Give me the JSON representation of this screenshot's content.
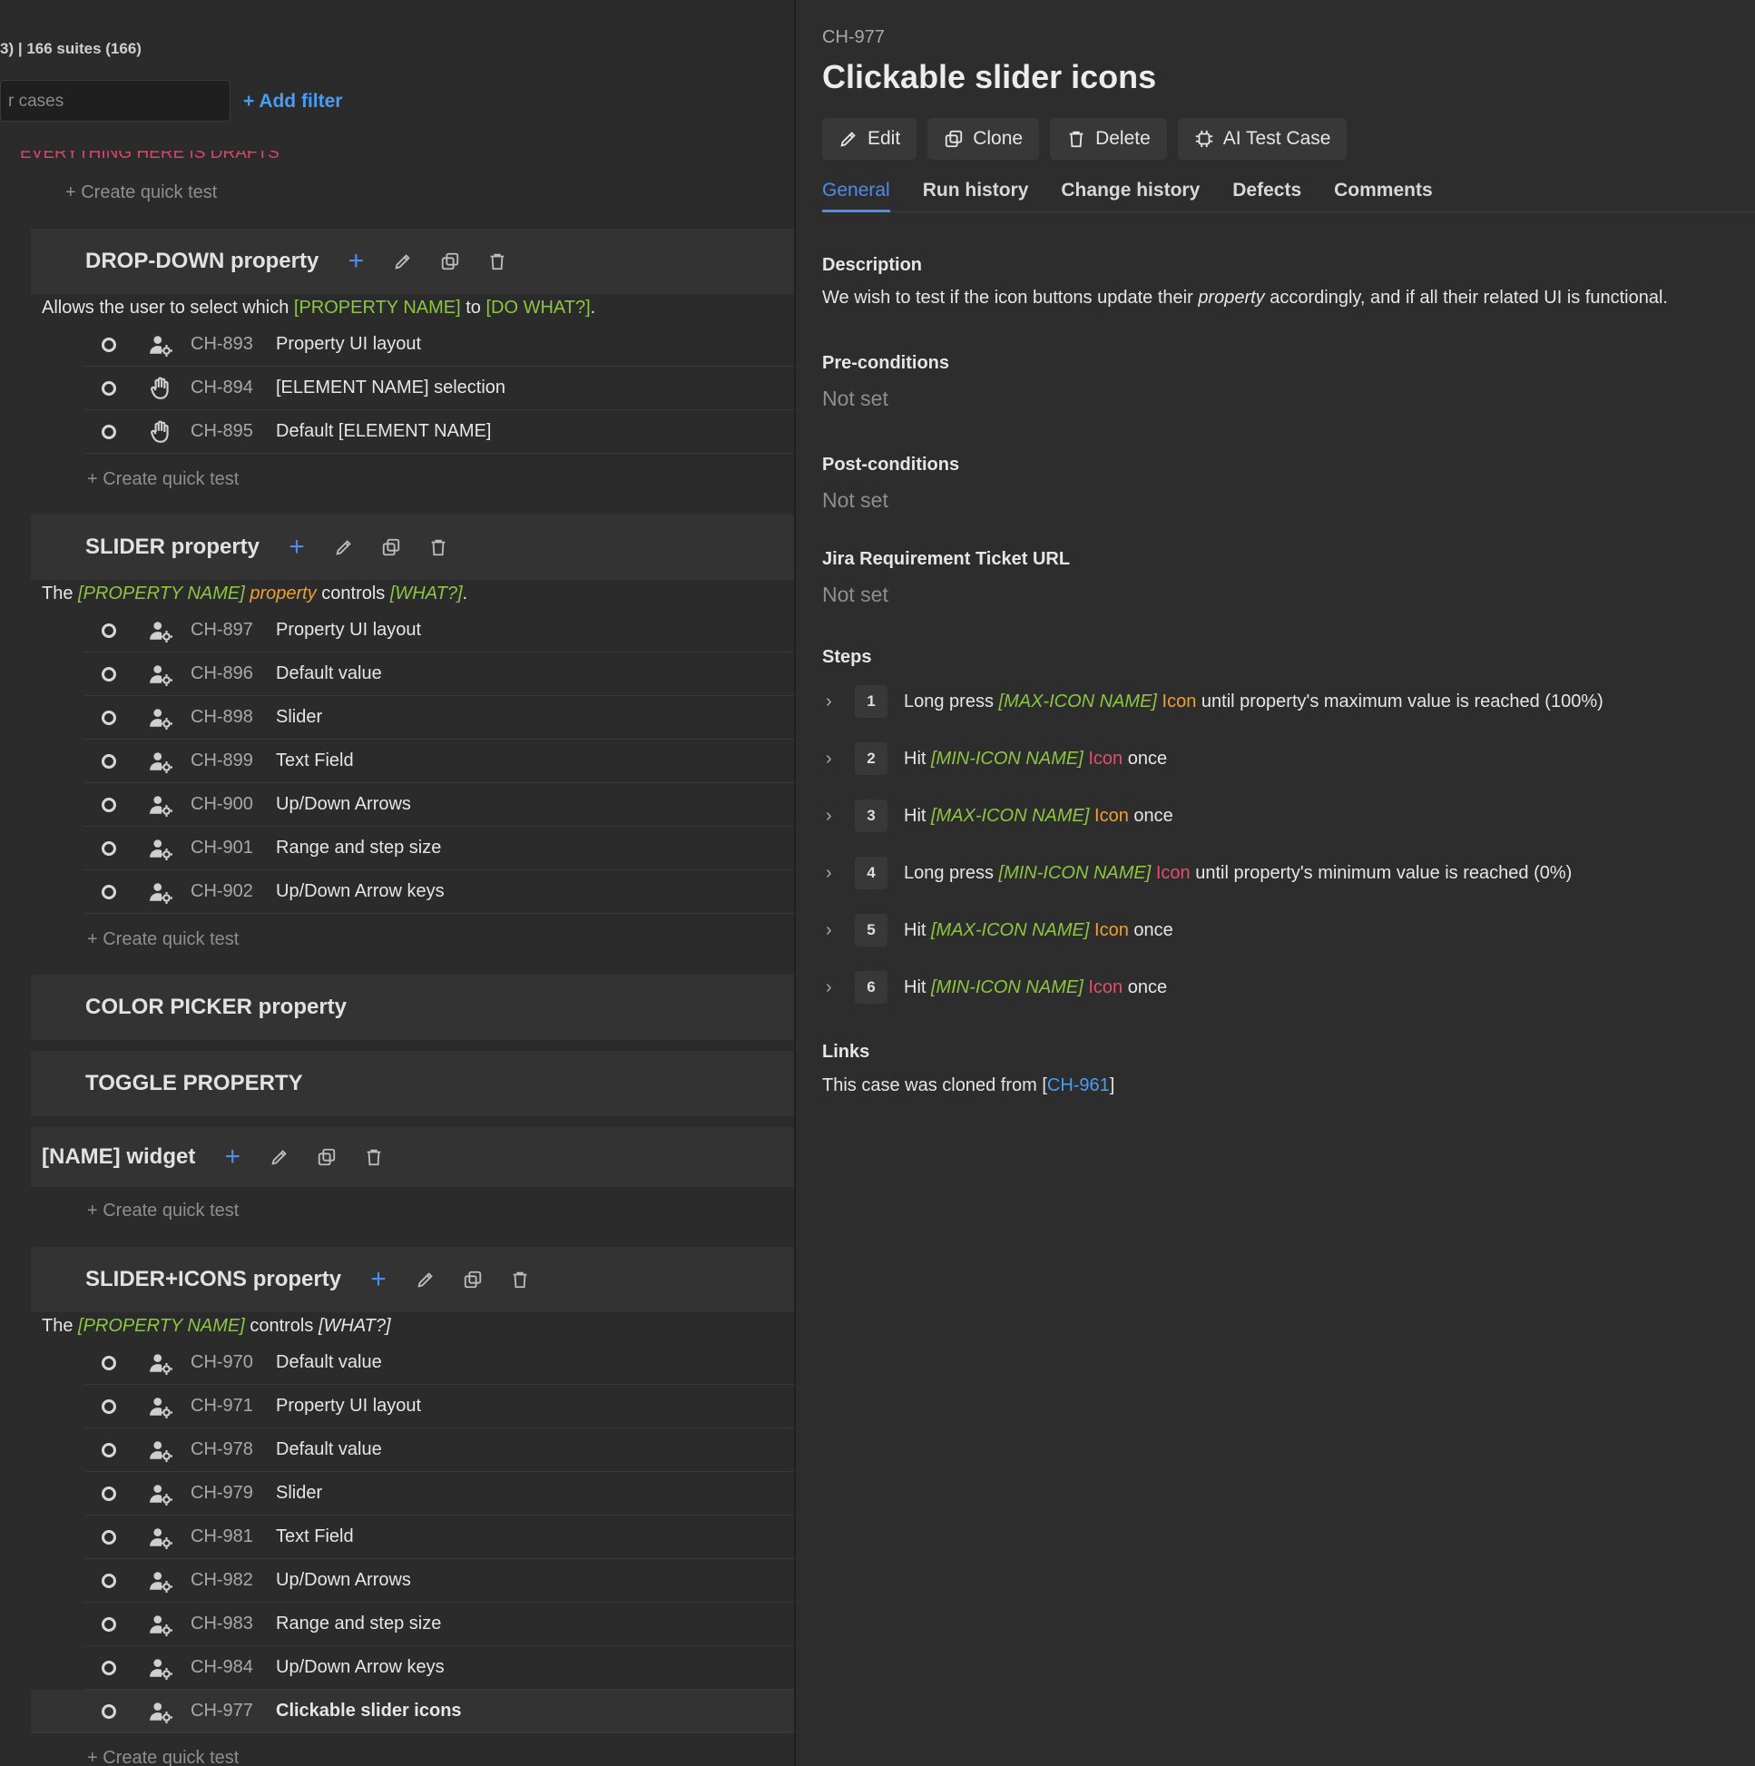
{
  "toolbar": {
    "counts": "3) | 166 suites (166)",
    "search_placeholder": "r cases",
    "add_filter": "+ Add filter"
  },
  "drafts_banner": "EVERYTHING HERE IS DRAFTS",
  "quick_test_label": "+ Create quick test",
  "suites": {
    "dropdown": {
      "title": "DROP-DOWN property",
      "desc": {
        "pre": "Allows the user to select which ",
        "name": "[PROPERTY NAME]",
        "mid": " to ",
        "what": "[DO WHAT?]",
        "post": "."
      },
      "cases": [
        {
          "id": "CH-893",
          "title": "Property UI layout",
          "type": "automated"
        },
        {
          "id": "CH-894",
          "title": "[ELEMENT NAME] selection",
          "type": "manual"
        },
        {
          "id": "CH-895",
          "title": "Default [ELEMENT NAME]",
          "type": "manual"
        }
      ]
    },
    "slider": {
      "title": "SLIDER property",
      "desc": {
        "pre": "The ",
        "name": "[PROPERTY NAME]",
        "word": " property",
        "mid": " controls ",
        "what": "[WHAT?]",
        "post": "."
      },
      "cases": [
        {
          "id": "CH-897",
          "title": "Property UI layout"
        },
        {
          "id": "CH-896",
          "title": "Default value"
        },
        {
          "id": "CH-898",
          "title": "Slider"
        },
        {
          "id": "CH-899",
          "title": "Text Field"
        },
        {
          "id": "CH-900",
          "title": "Up/Down Arrows"
        },
        {
          "id": "CH-901",
          "title": "Range and step size"
        },
        {
          "id": "CH-902",
          "title": "Up/Down Arrow keys"
        }
      ]
    },
    "colorpicker": {
      "title": "COLOR PICKER property"
    },
    "toggle": {
      "title": "TOGGLE PROPERTY"
    },
    "widget": {
      "title": "[NAME] widget"
    },
    "slidericons": {
      "title": "SLIDER+ICONS property",
      "desc": {
        "pre": "The ",
        "name": "[PROPERTY NAME]",
        "mid": " controls ",
        "what": "[WHAT?]"
      },
      "cases": [
        {
          "id": "CH-970",
          "title": "Default value"
        },
        {
          "id": "CH-971",
          "title": "Property UI layout"
        },
        {
          "id": "CH-978",
          "title": "Default value"
        },
        {
          "id": "CH-979",
          "title": "Slider"
        },
        {
          "id": "CH-981",
          "title": "Text Field"
        },
        {
          "id": "CH-982",
          "title": "Up/Down Arrows"
        },
        {
          "id": "CH-983",
          "title": "Range and step size"
        },
        {
          "id": "CH-984",
          "title": "Up/Down Arrow keys"
        },
        {
          "id": "CH-977",
          "title": "Clickable slider icons",
          "selected": true
        }
      ]
    }
  },
  "detail": {
    "id": "CH-977",
    "title": "Clickable slider icons",
    "buttons": {
      "edit": "Edit",
      "clone": "Clone",
      "delete": "Delete",
      "ai": "AI Test Case"
    },
    "tabs": [
      "General",
      "Run history",
      "Change history",
      "Defects",
      "Comments"
    ],
    "description_label": "Description",
    "description": {
      "pre": "We wish to test if the icon buttons update their ",
      "em": "property",
      "post": " accordingly, and if all their related UI is functional."
    },
    "preconditions_label": "Pre-conditions",
    "postconditions_label": "Post-conditions",
    "jira_label": "Jira Requirement Ticket URL",
    "not_set": "Not set",
    "steps_label": "Steps",
    "steps": [
      {
        "n": "1",
        "pre": "Long press ",
        "name": "[MAX-ICON NAME]",
        "icon": " Icon",
        "post": " until property's maximum value is reached (100%)"
      },
      {
        "n": "2",
        "pre": "Hit ",
        "name": "[MIN-ICON NAME]",
        "icon": " Icon",
        "post": " once"
      },
      {
        "n": "3",
        "pre": "Hit ",
        "name": "[MAX-ICON NAME]",
        "icon": " Icon",
        "post": " once"
      },
      {
        "n": "4",
        "pre": "Long press ",
        "name": "[MIN-ICON NAME]",
        "icon": " Icon",
        "post": " until property's minimum value is reached (0%)"
      },
      {
        "n": "5",
        "pre": "Hit ",
        "name": "[MAX-ICON NAME]",
        "icon": " Icon",
        "post": " once"
      },
      {
        "n": "6",
        "pre": "Hit ",
        "name": "[MIN-ICON NAME]",
        "icon": " Icon",
        "post": " once"
      }
    ],
    "links_label": "Links",
    "links": {
      "pre": "This case was cloned from [",
      "link": "CH-961",
      "post": "]"
    }
  },
  "colors": {
    "accent": "#4a8cf0",
    "green": "#8dc63f",
    "orange": "#f0a030",
    "red": "#e0506e",
    "draft": "#d9456a"
  }
}
